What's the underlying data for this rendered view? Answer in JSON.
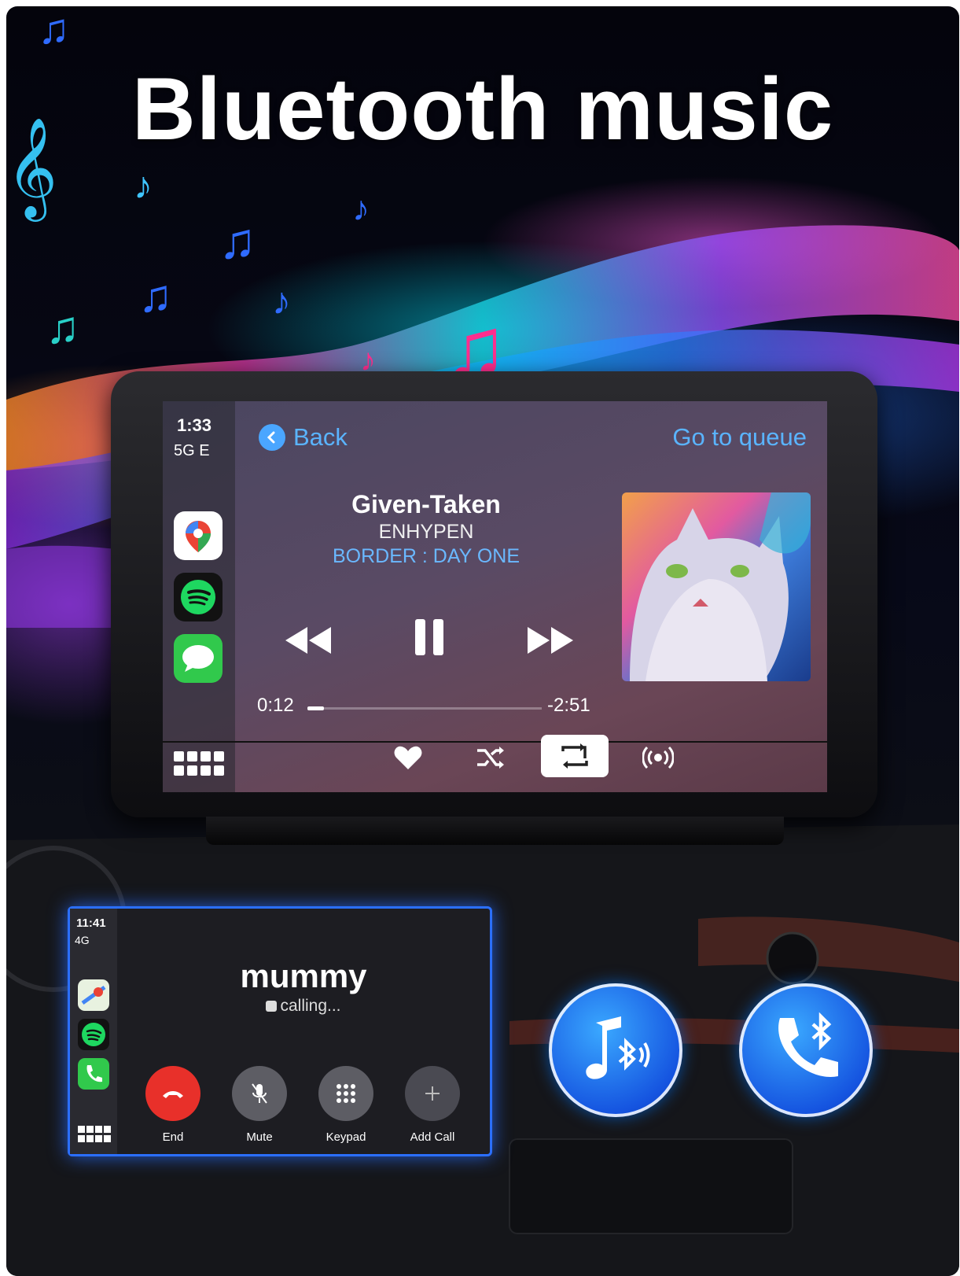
{
  "headline": "Bluetooth music",
  "head_unit": {
    "status": {
      "time": "1:33",
      "network": "5G E"
    },
    "nav": {
      "back_label": "Back",
      "queue_label": "Go to queue"
    },
    "now_playing": {
      "title": "Given-Taken",
      "artist": "ENHYPEN",
      "album": "BORDER : DAY ONE",
      "elapsed": "0:12",
      "remaining": "-2:51",
      "progress": 0.07
    },
    "sidebar_apps": [
      "maps-icon",
      "spotify-icon",
      "messages-icon"
    ],
    "bottom_controls": [
      "heart-icon",
      "shuffle-icon",
      "repeat-icon",
      "broadcast-icon"
    ]
  },
  "call_screen": {
    "status": {
      "time": "11:41",
      "network": "4G"
    },
    "contact": "mummy",
    "state": "calling...",
    "buttons": {
      "end": "End",
      "mute": "Mute",
      "keypad": "Keypad",
      "add_call": "Add Call"
    }
  },
  "colors": {
    "accent": "#5ab4ff",
    "end_call": "#e8302a",
    "badge_blue": "#1a66ee"
  }
}
